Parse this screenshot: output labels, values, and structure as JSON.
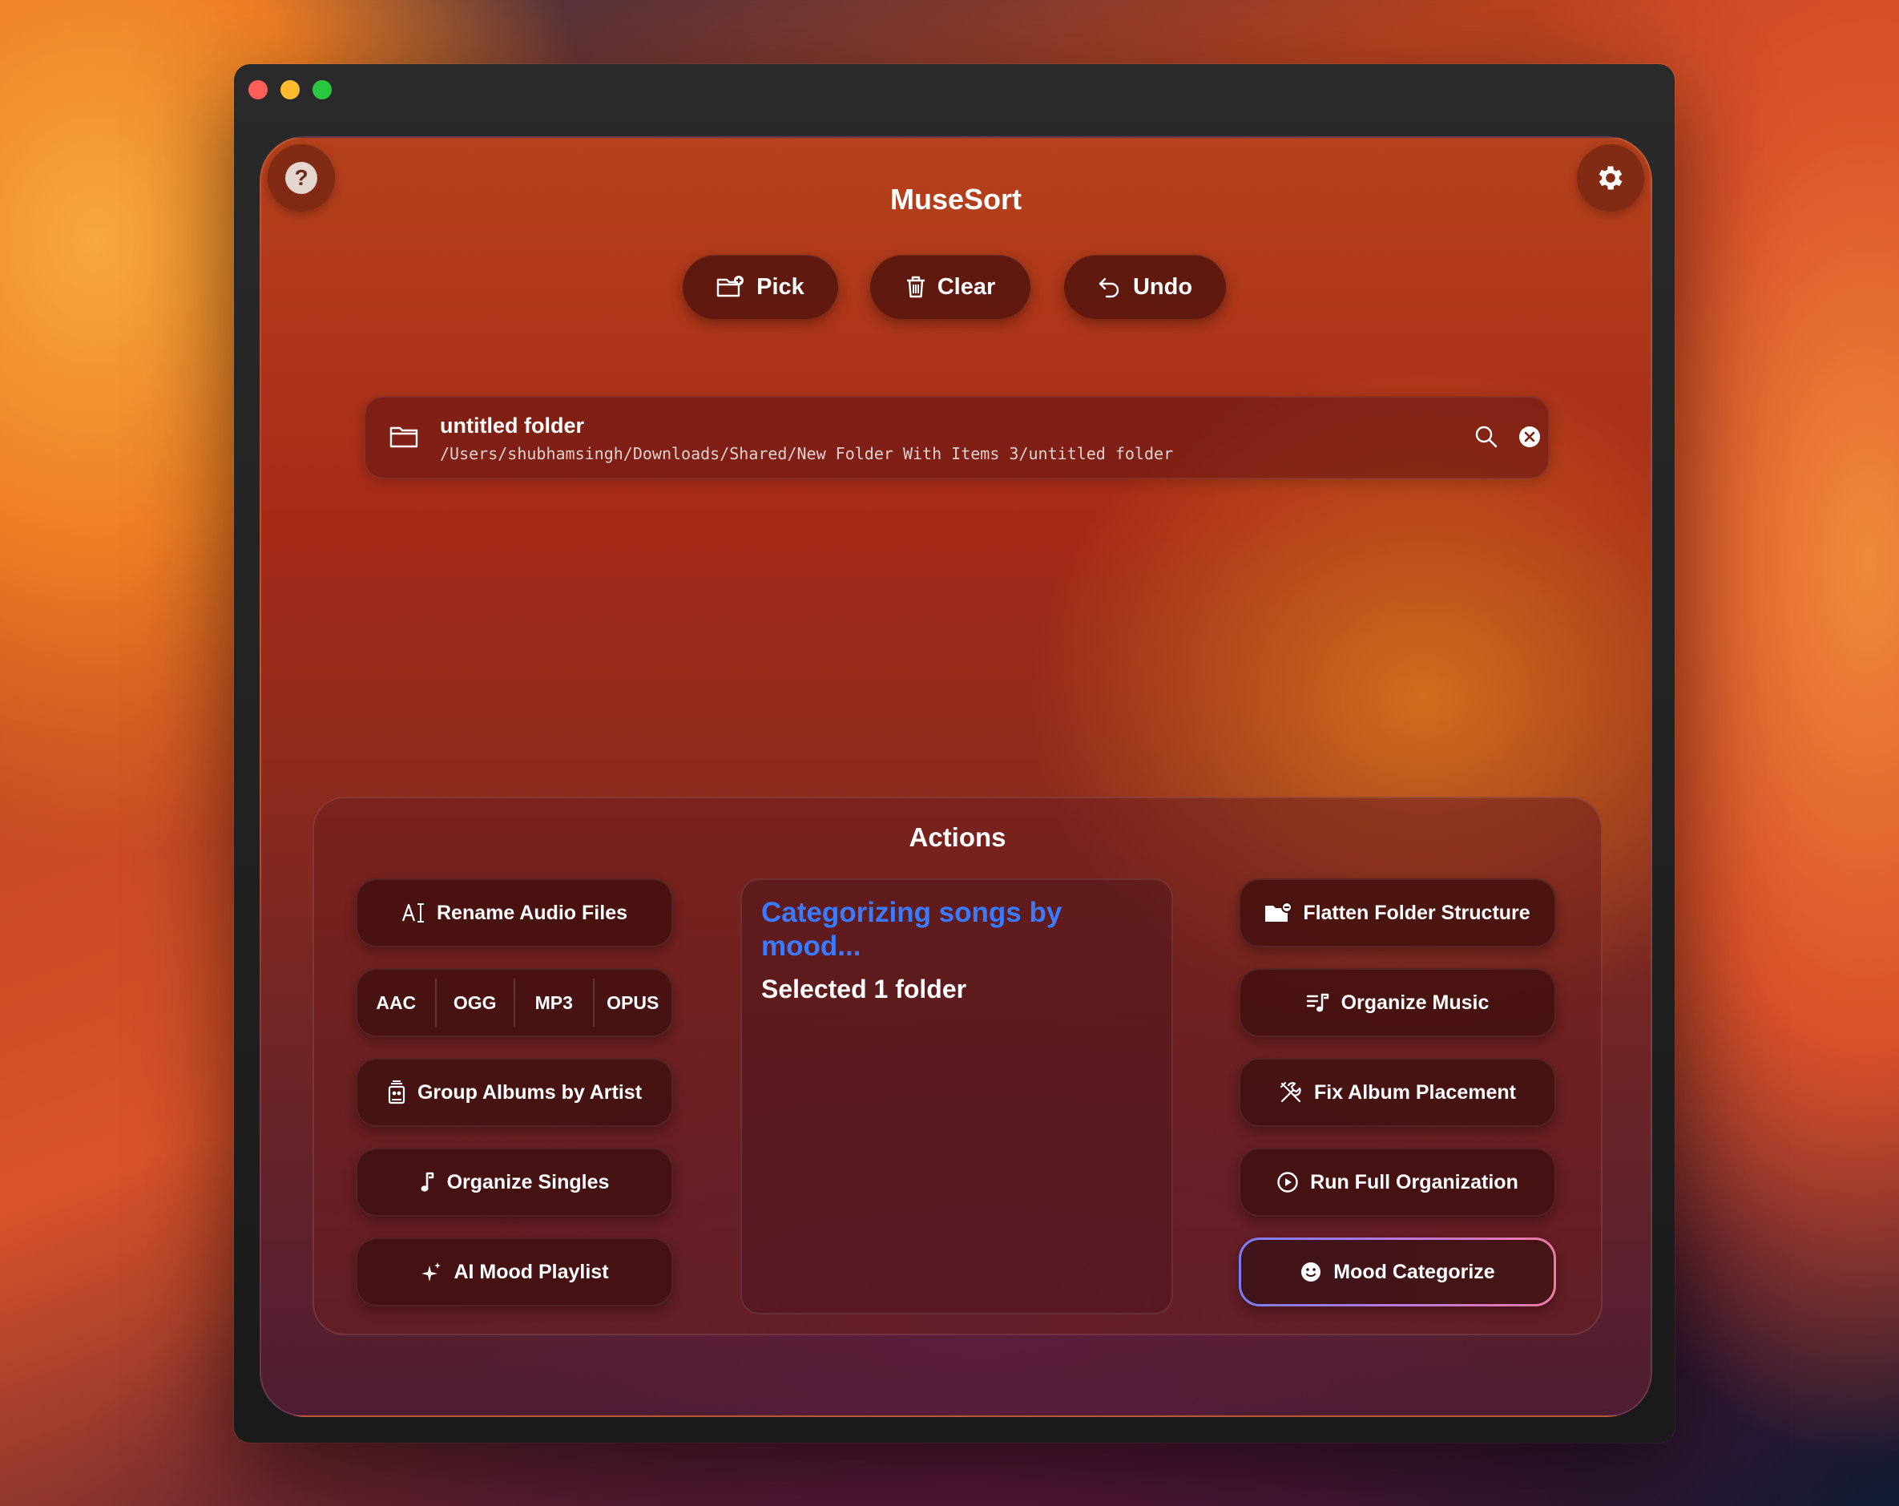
{
  "app": {
    "title": "MuseSort"
  },
  "toolbar": {
    "pick_label": "Pick",
    "clear_label": "Clear",
    "undo_label": "Undo"
  },
  "selected_folder": {
    "name": "untitled folder",
    "path": "/Users/shubhamsingh/Downloads/Shared/New Folder With Items 3/untitled folder"
  },
  "actions": {
    "title": "Actions",
    "left": [
      {
        "label": "Rename Audio Files",
        "icon": "text-cursor-icon"
      },
      {
        "label": "Group Albums by Artist",
        "icon": "album-stack-icon"
      },
      {
        "label": "Organize Singles",
        "icon": "music-note-icon"
      },
      {
        "label": "AI Mood Playlist",
        "icon": "sparkles-icon"
      }
    ],
    "formats": [
      "AAC",
      "OGG",
      "MP3",
      "OPUS"
    ],
    "right": [
      {
        "label": "Flatten Folder Structure",
        "icon": "folder-badge-icon"
      },
      {
        "label": "Organize Music",
        "icon": "music-list-icon"
      },
      {
        "label": "Fix Album Placement",
        "icon": "tools-icon"
      },
      {
        "label": "Run Full Organization",
        "icon": "play-circle-icon"
      },
      {
        "label": "Mood Categorize",
        "icon": "smiley-icon"
      }
    ],
    "status": {
      "title": "Categorizing songs by mood...",
      "subtitle": "Selected 1 folder"
    }
  },
  "colors": {
    "status_accent": "#3a7bff",
    "active_border_from": "#7a7cf2",
    "active_border_to": "#f07aa0"
  }
}
